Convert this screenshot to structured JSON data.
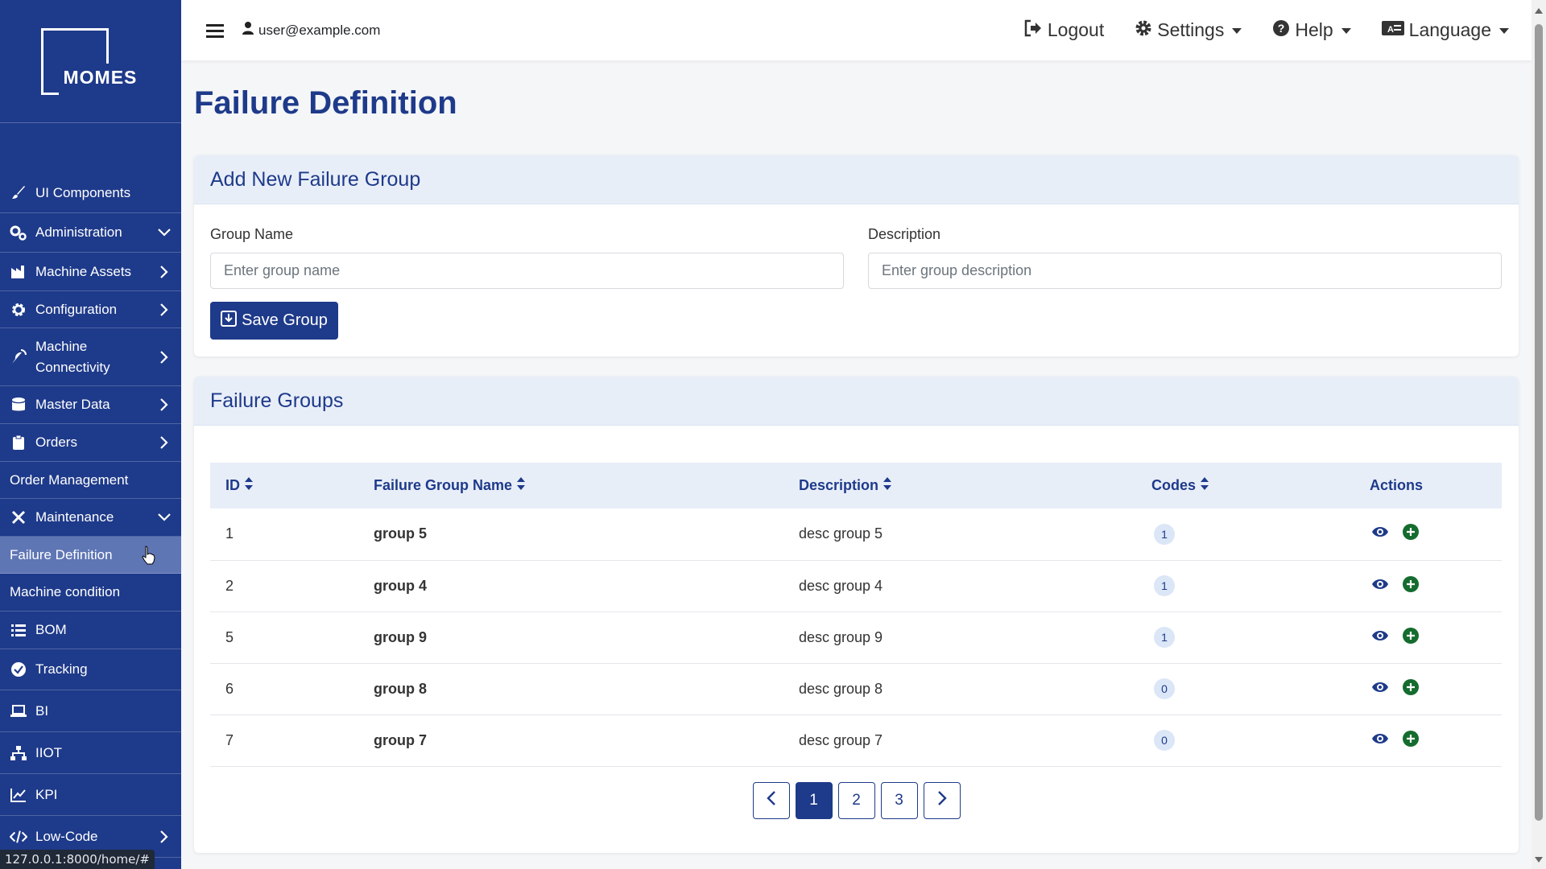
{
  "app": {
    "logo_text": "MOMES",
    "status_url": "127.0.0.1:8000/home/#"
  },
  "sidebar": {
    "items": [
      {
        "label": "UI Components",
        "icon": "brush-icon"
      },
      {
        "label": "Administration",
        "icon": "gears-icon",
        "chevron": "down"
      },
      {
        "label": "Machine Assets",
        "icon": "industry-icon",
        "chevron": "right"
      },
      {
        "label": "Configuration",
        "icon": "gear-icon",
        "chevron": "right"
      },
      {
        "label": "Machine Connectivity",
        "icon": "satellite-dish-icon",
        "chevron": "right"
      },
      {
        "label": "Master Data",
        "icon": "database-icon",
        "chevron": "right"
      },
      {
        "label": "Orders",
        "icon": "clipboard-icon",
        "chevron": "right"
      },
      {
        "label": "Order Management"
      },
      {
        "label": "Maintenance",
        "icon": "tools-icon",
        "chevron": "down"
      },
      {
        "label": "Failure Definition",
        "active": true
      },
      {
        "label": "Machine condition"
      },
      {
        "label": "BOM",
        "icon": "list-icon"
      },
      {
        "label": "Tracking",
        "icon": "check-circle-icon"
      },
      {
        "label": "BI",
        "icon": "laptop-icon"
      },
      {
        "label": "IIOT",
        "icon": "network-icon"
      },
      {
        "label": "KPI",
        "icon": "chart-line-icon"
      },
      {
        "label": "Low-Code",
        "icon": "code-icon",
        "chevron": "right"
      }
    ]
  },
  "topbar": {
    "user": "user@example.com",
    "logout": "Logout",
    "settings": "Settings",
    "help": "Help",
    "language": "Language"
  },
  "page": {
    "title": "Failure Definition"
  },
  "add_group": {
    "header": "Add New Failure Group",
    "group_name_label": "Group Name",
    "group_name_placeholder": "Enter group name",
    "description_label": "Description",
    "description_placeholder": "Enter group description",
    "save_label": "Save Group"
  },
  "groups": {
    "header": "Failure Groups",
    "columns": [
      "ID",
      "Failure Group Name",
      "Description",
      "Codes",
      "Actions"
    ],
    "rows": [
      {
        "id": "1",
        "name": "group 5",
        "description": "desc group 5",
        "codes": "1"
      },
      {
        "id": "2",
        "name": "group 4",
        "description": "desc group 4",
        "codes": "1"
      },
      {
        "id": "5",
        "name": "group 9",
        "description": "desc group 9",
        "codes": "1"
      },
      {
        "id": "6",
        "name": "group 8",
        "description": "desc group 8",
        "codes": "0"
      },
      {
        "id": "7",
        "name": "group 7",
        "description": "desc group 7",
        "codes": "0"
      }
    ],
    "pages": [
      "1",
      "2",
      "3"
    ],
    "current_page": "1"
  },
  "colors": {
    "primary": "#1e3a8a",
    "sidebar_active": "#5f76b5",
    "success": "#146c2e"
  }
}
